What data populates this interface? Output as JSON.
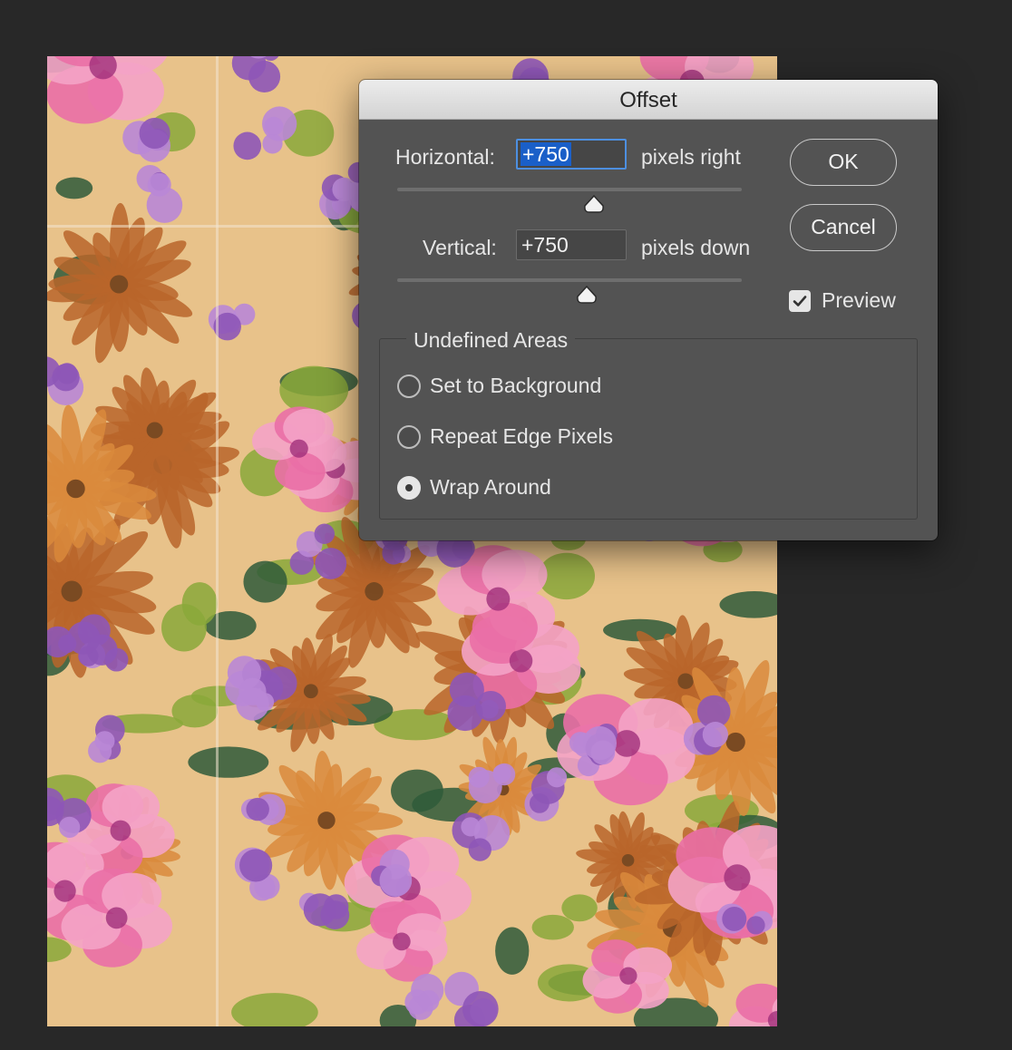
{
  "dialog": {
    "title": "Offset",
    "horizontal": {
      "label": "Horizontal:",
      "value": "+750",
      "unit": "pixels right",
      "slider_fraction": 0.57
    },
    "vertical": {
      "label": "Vertical:",
      "value": "+750",
      "unit": "pixels down",
      "slider_fraction": 0.55
    },
    "buttons": {
      "ok": "OK",
      "cancel": "Cancel"
    },
    "preview": {
      "label": "Preview",
      "checked": true
    },
    "undefined_areas": {
      "title": "Undefined Areas",
      "options": [
        "Set to Background",
        "Repeat Edge Pixels",
        "Wrap Around"
      ],
      "selected": "Wrap Around"
    }
  },
  "colors": {
    "app_background": "#282828",
    "dialog_background": "#535353",
    "selection_highlight": "#1a5fc8",
    "focus_ring": "#4d8fe0",
    "pattern_orange": "#d98a3c",
    "pattern_pink": "#ea6fa6",
    "pattern_purple": "#8e56b7",
    "pattern_green": "#8aa83a",
    "pattern_dark_green": "#2f5a3a"
  }
}
